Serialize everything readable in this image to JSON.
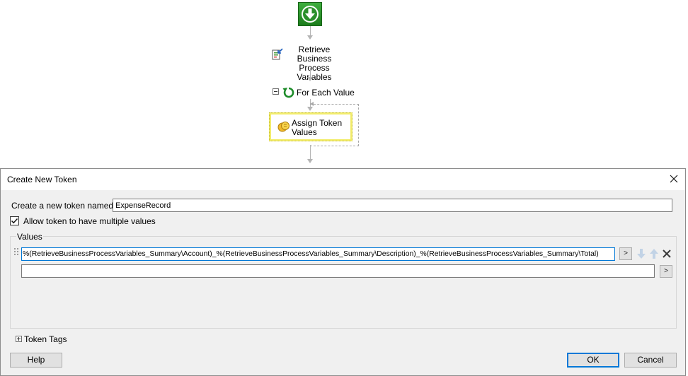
{
  "workflow": {
    "step_retrieve": {
      "line1": "Retrieve Business",
      "line2": "Process Variables"
    },
    "step_foreach": {
      "label": "For Each Value"
    },
    "step_assign": {
      "line1": "Assign Token",
      "line2": "Values"
    }
  },
  "dialog": {
    "title": "Create New Token",
    "name_label": "Create a new token named:",
    "name_value": "ExpenseRecord",
    "allow_multiple_label": "Allow token to have multiple values",
    "allow_multiple_checked": true,
    "values_group_label": "Values",
    "values": [
      "%(RetrieveBusinessProcessVariables_Summary\\Account)_%(RetrieveBusinessProcessVariables_Summary\\Description)_%(RetrieveBusinessProcessVariables_Summary\\Total)",
      ""
    ],
    "expand_button_label": ">",
    "token_tags_label": "Token Tags",
    "help_button": "Help",
    "ok_button": "OK",
    "cancel_button": "Cancel"
  },
  "colors": {
    "start_green": "#2e9a2e",
    "highlight_yellow": "#f2ec6b",
    "accent_blue": "#0078d7"
  },
  "icons": [
    "download-arrow-icon",
    "retrieve-variables-icon",
    "loop-icon",
    "token-coins-icon",
    "close-icon",
    "move-down-icon",
    "move-up-icon",
    "delete-icon",
    "checkmark-icon",
    "expand-plus-icon",
    "collapse-minus-icon"
  ]
}
